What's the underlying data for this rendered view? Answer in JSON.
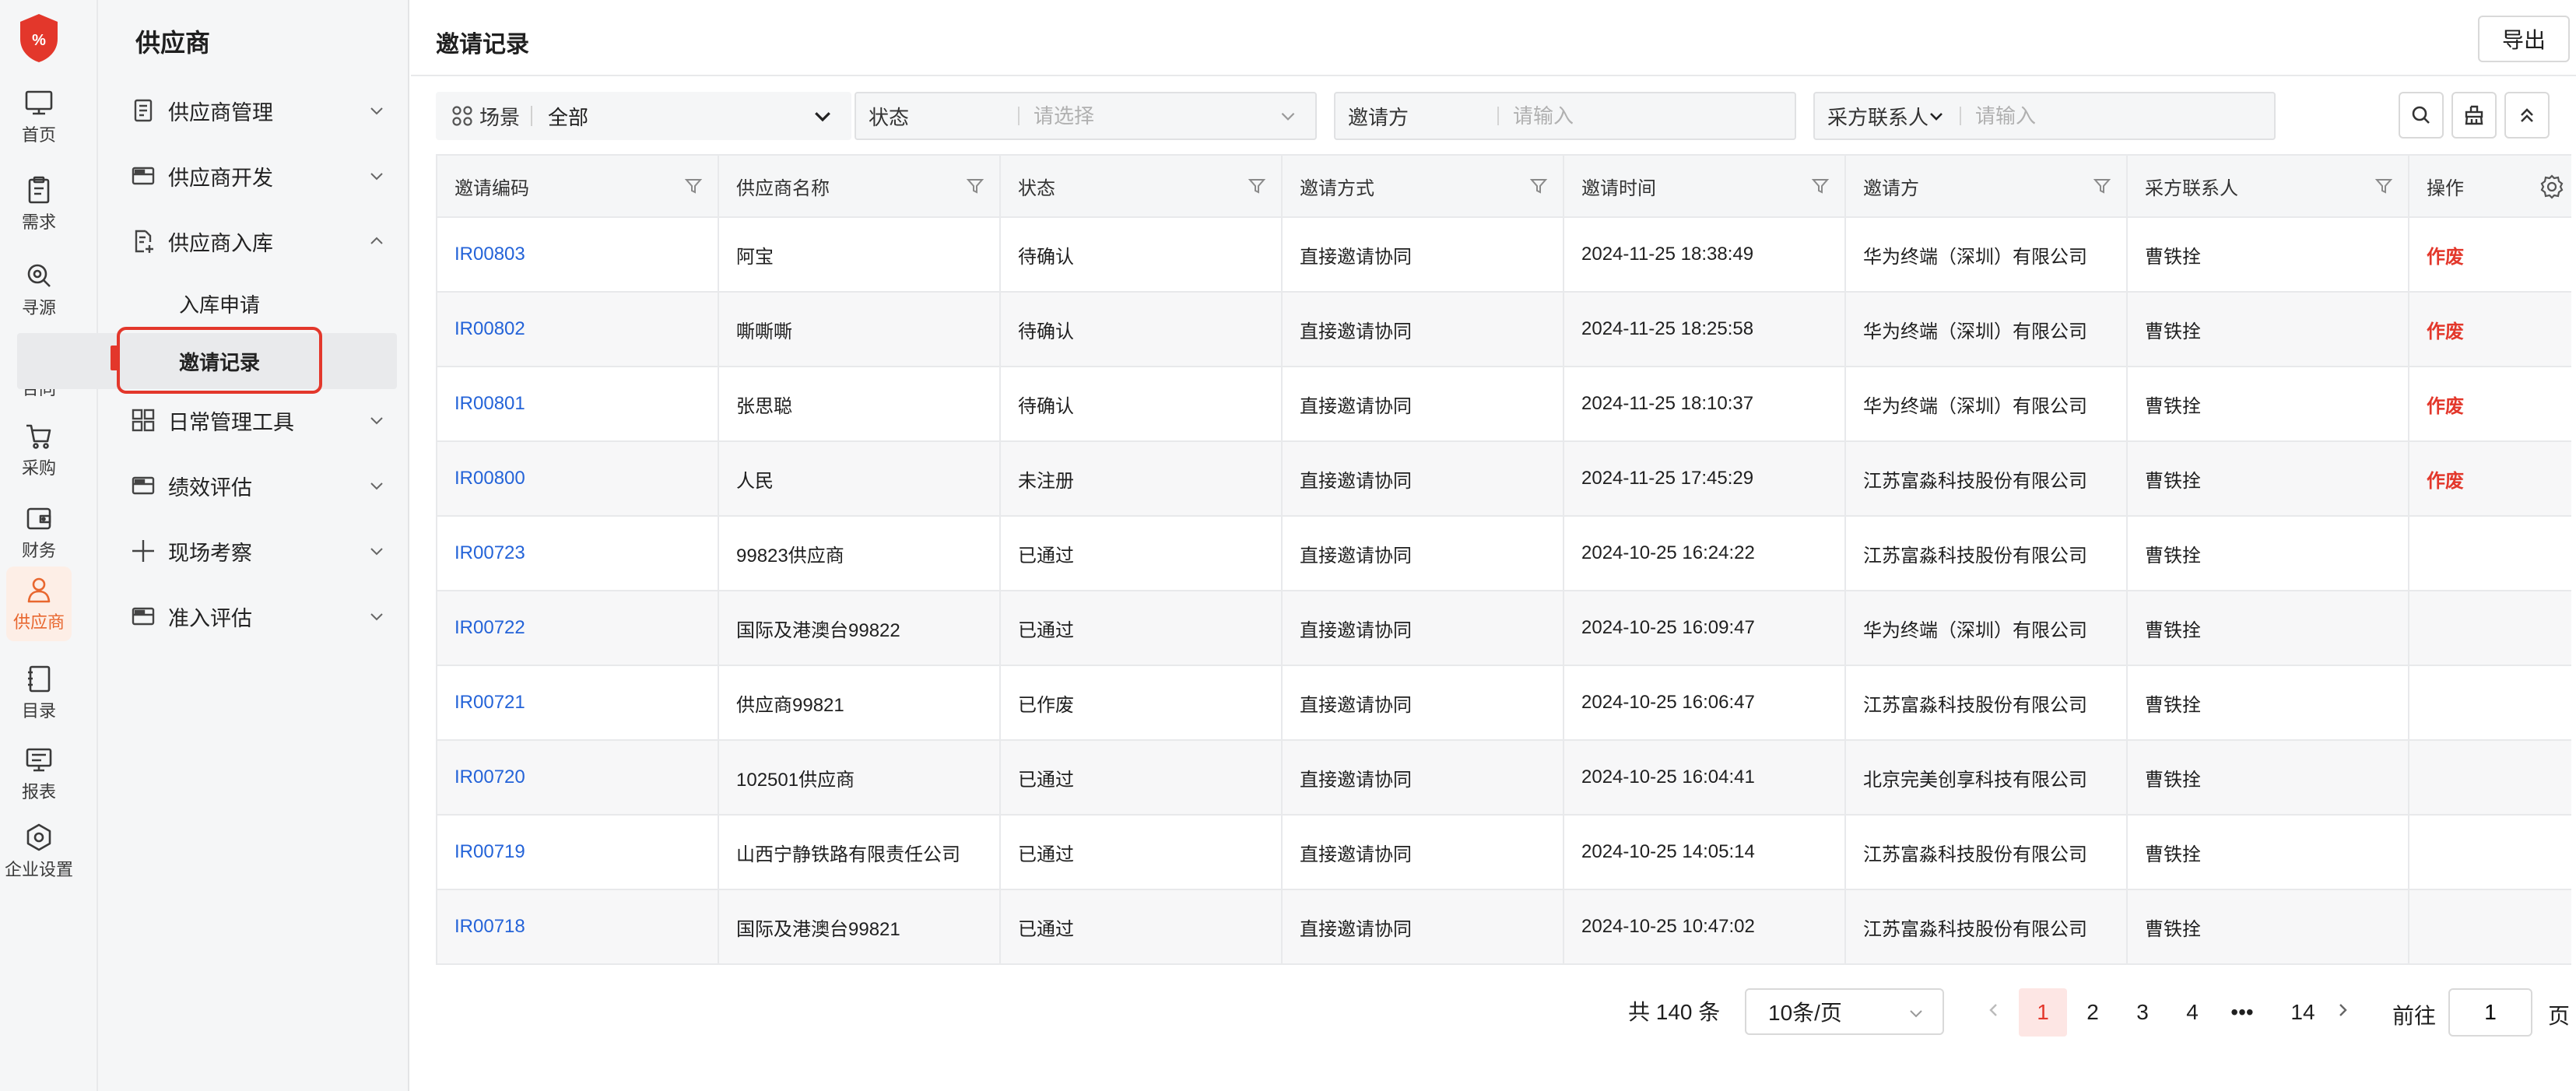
{
  "rail": {
    "items": [
      {
        "label": "首页",
        "icon": "monitor-icon"
      },
      {
        "label": "需求",
        "icon": "clipboard-icon"
      },
      {
        "label": "寻源",
        "icon": "search-source-icon"
      },
      {
        "label": "合同",
        "icon": "contract-person-icon"
      },
      {
        "label": "采购",
        "icon": "cart-icon"
      },
      {
        "label": "财务",
        "icon": "wallet-icon"
      },
      {
        "label": "供应商",
        "icon": "supplier-icon",
        "active": true
      },
      {
        "label": "目录",
        "icon": "catalog-icon"
      },
      {
        "label": "报表",
        "icon": "report-icon"
      },
      {
        "label": "企业设置",
        "icon": "settings-hex-icon"
      }
    ]
  },
  "subnav": {
    "title": "供应商",
    "groups": [
      {
        "label": "供应商管理",
        "icon": "list-doc-icon",
        "expanded": false
      },
      {
        "label": "供应商开发",
        "icon": "card-icon",
        "expanded": false
      },
      {
        "label": "供应商入库",
        "icon": "doc-add-icon",
        "expanded": true
      },
      {
        "label": "日常管理工具",
        "icon": "grid-icon",
        "expanded": false
      },
      {
        "label": "绩效评估",
        "icon": "card-icon",
        "expanded": false
      },
      {
        "label": "现场考察",
        "icon": "plus-icon",
        "expanded": false
      },
      {
        "label": "准入评估",
        "icon": "card-icon",
        "expanded": false
      }
    ],
    "sub_items": [
      {
        "label": "入库申请"
      },
      {
        "label": "邀请记录",
        "active": true
      }
    ]
  },
  "header": {
    "title": "邀请记录",
    "export_label": "导出"
  },
  "filters": {
    "scene_label": "场景",
    "scene_value": "全部",
    "status_label": "状态",
    "status_placeholder": "请选择",
    "inviter_label": "邀请方",
    "inviter_placeholder": "请输入",
    "contact_label": "采方联系人",
    "contact_placeholder": "请输入"
  },
  "table": {
    "columns": [
      "邀请编码",
      "供应商名称",
      "状态",
      "邀请方式",
      "邀请时间",
      "邀请方",
      "采方联系人",
      "操作"
    ],
    "rows": [
      {
        "code": "IR00803",
        "supplier": "阿宝",
        "status": "待确认",
        "method": "直接邀请协同",
        "time": "2024-11-25 18:38:49",
        "inviter": "华为终端（深圳）有限公司",
        "contact": "曹铁拴",
        "action": "作废"
      },
      {
        "code": "IR00802",
        "supplier": "嘶嘶嘶",
        "status": "待确认",
        "method": "直接邀请协同",
        "time": "2024-11-25 18:25:58",
        "inviter": "华为终端（深圳）有限公司",
        "contact": "曹铁拴",
        "action": "作废"
      },
      {
        "code": "IR00801",
        "supplier": "张思聪",
        "status": "待确认",
        "method": "直接邀请协同",
        "time": "2024-11-25 18:10:37",
        "inviter": "华为终端（深圳）有限公司",
        "contact": "曹铁拴",
        "action": "作废"
      },
      {
        "code": "IR00800",
        "supplier": "人民",
        "status": "未注册",
        "method": "直接邀请协同",
        "time": "2024-11-25 17:45:29",
        "inviter": "江苏富淼科技股份有限公司",
        "contact": "曹铁拴",
        "action": "作废"
      },
      {
        "code": "IR00723",
        "supplier": "99823供应商",
        "status": "已通过",
        "method": "直接邀请协同",
        "time": "2024-10-25 16:24:22",
        "inviter": "江苏富淼科技股份有限公司",
        "contact": "曹铁拴",
        "action": ""
      },
      {
        "code": "IR00722",
        "supplier": "国际及港澳台99822",
        "status": "已通过",
        "method": "直接邀请协同",
        "time": "2024-10-25 16:09:47",
        "inviter": "华为终端（深圳）有限公司",
        "contact": "曹铁拴",
        "action": ""
      },
      {
        "code": "IR00721",
        "supplier": "供应商99821",
        "status": "已作废",
        "method": "直接邀请协同",
        "time": "2024-10-25 16:06:47",
        "inviter": "江苏富淼科技股份有限公司",
        "contact": "曹铁拴",
        "action": ""
      },
      {
        "code": "IR00720",
        "supplier": "102501供应商",
        "status": "已通过",
        "method": "直接邀请协同",
        "time": "2024-10-25 16:04:41",
        "inviter": "北京完美创享科技有限公司",
        "contact": "曹铁拴",
        "action": ""
      },
      {
        "code": "IR00719",
        "supplier": "山西宁静铁路有限责任公司",
        "status": "已通过",
        "method": "直接邀请协同",
        "time": "2024-10-25 14:05:14",
        "inviter": "江苏富淼科技股份有限公司",
        "contact": "曹铁拴",
        "action": ""
      },
      {
        "code": "IR00718",
        "supplier": "国际及港澳台99821",
        "status": "已通过",
        "method": "直接邀请协同",
        "time": "2024-10-25 10:47:02",
        "inviter": "江苏富淼科技股份有限公司",
        "contact": "曹铁拴",
        "action": ""
      }
    ]
  },
  "pagination": {
    "total_text": "共 140 条",
    "page_size": "10条/页",
    "pages": [
      "1",
      "2",
      "3",
      "4",
      "•••",
      "14"
    ],
    "current": "1",
    "goto_label": "前往",
    "goto_value": "1",
    "page_suffix": "页"
  },
  "colors": {
    "accent": "#e8672f",
    "danger": "#e3372b",
    "link": "#2463d8"
  }
}
